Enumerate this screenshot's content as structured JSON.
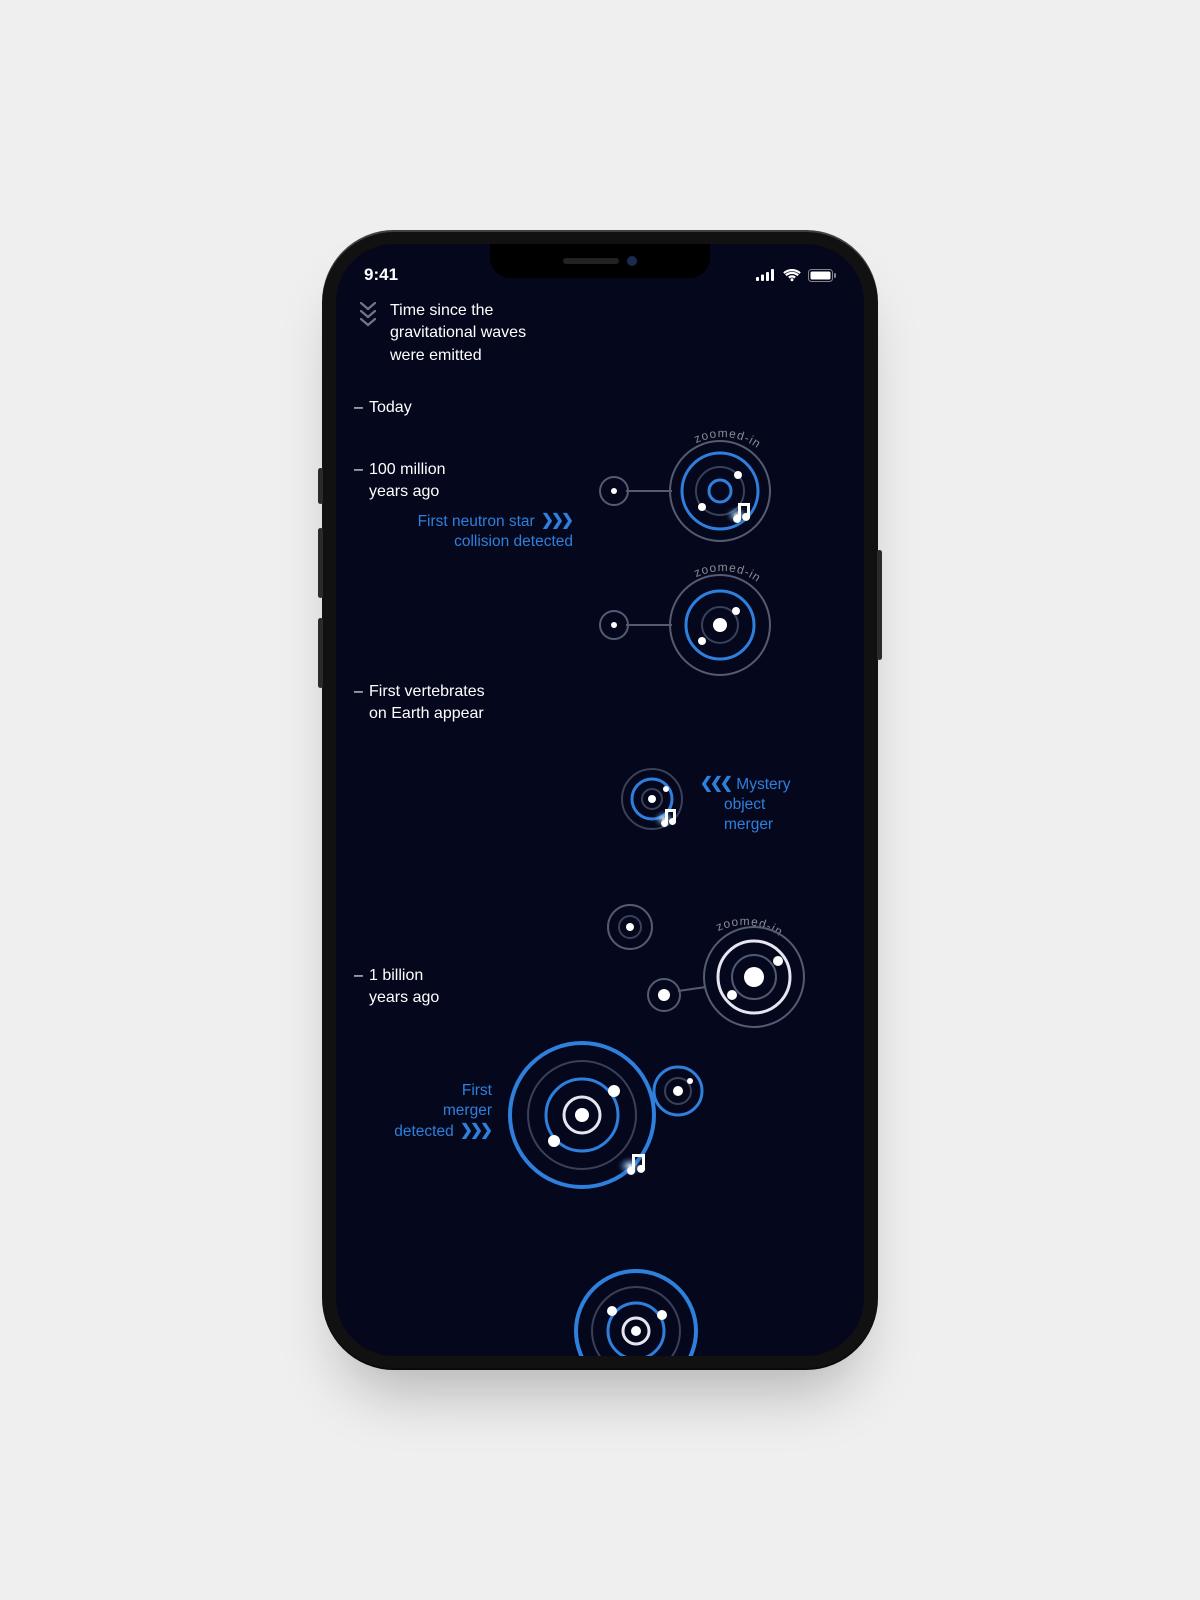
{
  "status_bar": {
    "time": "9:41"
  },
  "header": {
    "title_line1": "Time since the",
    "title_line2": "gravitational waves",
    "title_line3": "were emitted"
  },
  "timeline": {
    "ticks": {
      "today": "Today",
      "t100m_1": "100 million",
      "t100m_2": "years ago",
      "vert_1": "First vertebrates",
      "vert_2": "on Earth appear",
      "t1b_1": "1 billion",
      "t1b_2": "years ago"
    },
    "events": {
      "neutron_1": "First neutron star",
      "neutron_2": "collision detected",
      "mystery_1": "Mystery",
      "mystery_2": "object",
      "mystery_3": "merger",
      "firstmerger_1": "First",
      "firstmerger_2": "merger",
      "firstmerger_3": "detected"
    },
    "zoom_label": "zoomed-in",
    "arrows_right": "❯❯❯",
    "arrows_left": "❮❮❮"
  }
}
